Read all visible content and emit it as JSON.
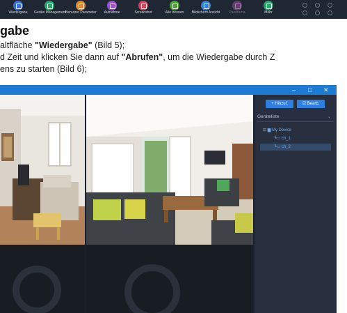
{
  "toolbar": {
    "items": [
      {
        "label": "Wiedergabe",
        "icon": "playback-icon",
        "color": "#3b6fd8"
      },
      {
        "label": "Geräte Management",
        "icon": "device-management-icon",
        "color": "#2aa86a"
      },
      {
        "label": "Benutzer Parameter",
        "icon": "user-parameter-icon",
        "color": "#e0882e"
      },
      {
        "label": "Aufnahme",
        "icon": "record-icon",
        "color": "#9a4fd6"
      },
      {
        "label": "Screenshot",
        "icon": "screenshot-icon",
        "color": "#d0445c"
      },
      {
        "label": "Alle trennen",
        "icon": "disconnect-icon",
        "color": "#4f9f3a"
      },
      {
        "label": "Bildschirm Ansicht",
        "icon": "screen-view-icon",
        "color": "#2f7fe0"
      },
      {
        "label": "Panorama",
        "icon": "panorama-icon",
        "color": "#b04fb6"
      },
      {
        "label": "Mehr",
        "icon": "more-icon",
        "color": "#2aa86a"
      }
    ]
  },
  "heading": "gabe",
  "text": {
    "line1_prefix": "altfläche ",
    "line1_bold": "\"Wiedergabe\"",
    "line1_suffix": " (Bild 5);",
    "line2_prefix": "d Zeit und klicken Sie dann auf ",
    "line2_bold": "\"Abrufen\"",
    "line2_suffix": ", um die Wiedergabe durch Z",
    "line3": "ens zu starten (Bild 6);"
  },
  "app": {
    "title_bar_color": "#1d7bd3",
    "window_controls": [
      "–",
      "□",
      "✕"
    ],
    "panel": {
      "add_button": "+ Hinzuf.",
      "edit_button": "☑ Bearb.",
      "device_list_title": "Geräteliste",
      "tree": [
        {
          "label": "My Device",
          "level": 0
        },
        {
          "label": "ch_1",
          "level": 1
        },
        {
          "label": "ch_2",
          "level": 1,
          "selected": true
        }
      ]
    }
  }
}
